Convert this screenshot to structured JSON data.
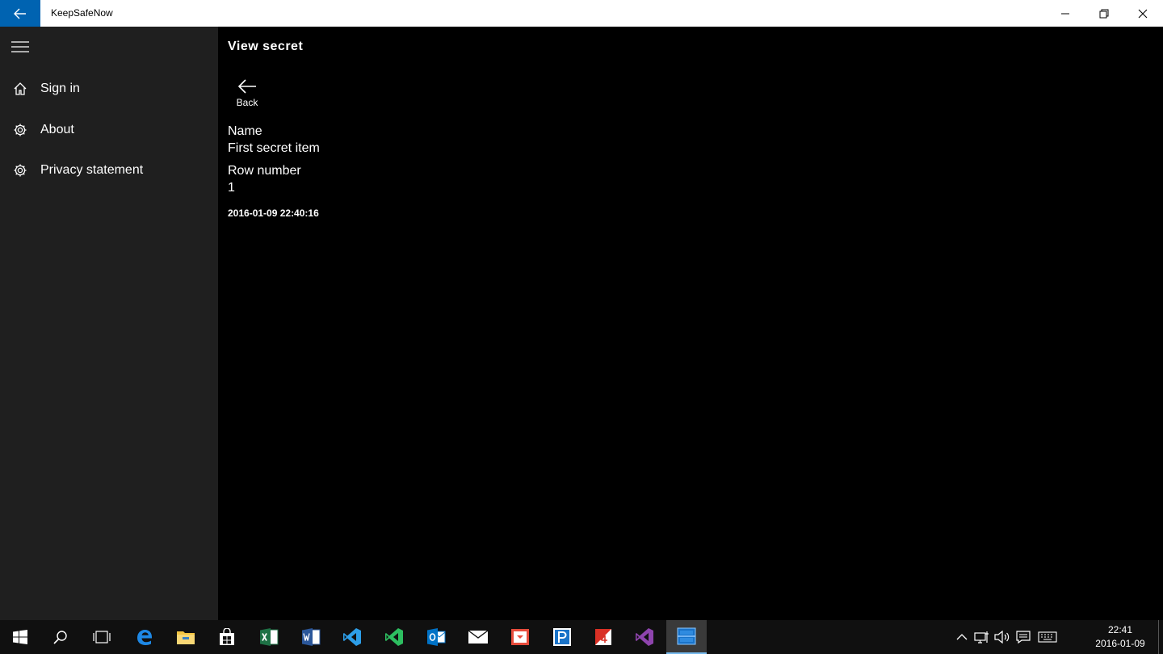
{
  "window": {
    "title": "KeepSafeNow"
  },
  "sidebar": {
    "items": [
      {
        "label": "Sign in",
        "icon": "home-icon"
      },
      {
        "label": "About",
        "icon": "gear-icon"
      },
      {
        "label": "Privacy statement",
        "icon": "gear-icon"
      }
    ]
  },
  "main": {
    "page_title": "View secret",
    "back_label": "Back",
    "fields": [
      {
        "label": "Name",
        "value": "First secret item"
      },
      {
        "label": "Row number",
        "value": "1"
      }
    ],
    "timestamp": "2016-01-09 22:40:16"
  },
  "taskbar": {
    "apps": [
      "start-icon",
      "search-icon",
      "task-view-icon",
      "edge-icon",
      "file-explorer-icon",
      "store-icon",
      "excel-icon",
      "word-icon",
      "vscode-icon",
      "visual-studio-green-icon",
      "outlook-icon",
      "mail-icon",
      "app-red-icon",
      "app-blue-icon",
      "app-red2-icon",
      "visual-studio-icon",
      "keepsafenow-icon"
    ],
    "clock": {
      "time": "22:41",
      "date": "2016-01-09"
    }
  },
  "colors": {
    "accent": "#0063b1",
    "sidebar_bg": "#1f1f1f",
    "main_bg": "#000000",
    "taskbar_bg": "#101010"
  }
}
